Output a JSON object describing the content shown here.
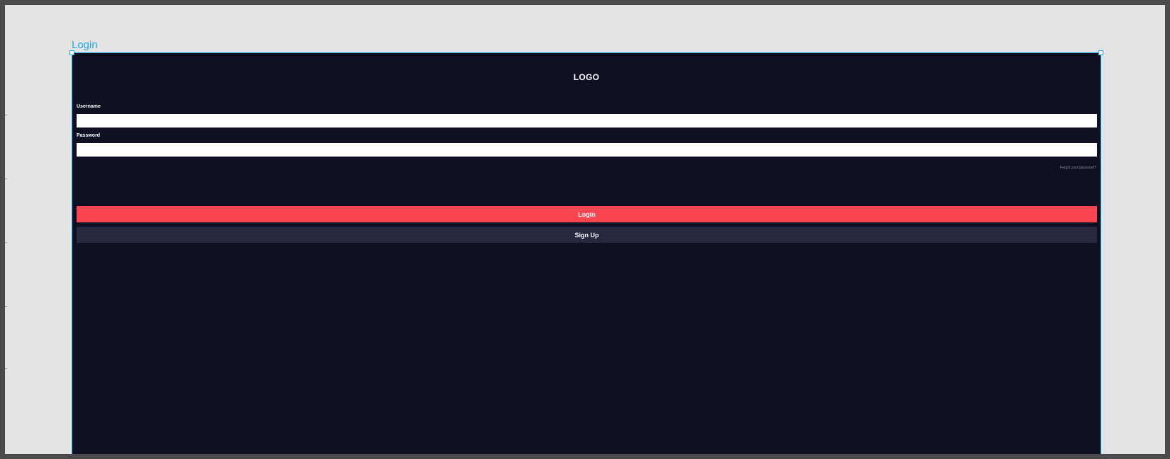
{
  "frame": {
    "label": "Login"
  },
  "login_screen": {
    "logo_text": "LOGO",
    "username": {
      "label": "Username",
      "value": ""
    },
    "password": {
      "label": "Password",
      "value": ""
    },
    "forgot_password_link": "Forgot your password?",
    "login_button": "Login",
    "signup_button": "Sign Up"
  },
  "colors": {
    "canvas_bg": "#e4e4e4",
    "screen_bg": "#0e0f22",
    "selection": "#1ea7e6",
    "primary_button": "#f94452",
    "secondary_button": "#26283f"
  }
}
